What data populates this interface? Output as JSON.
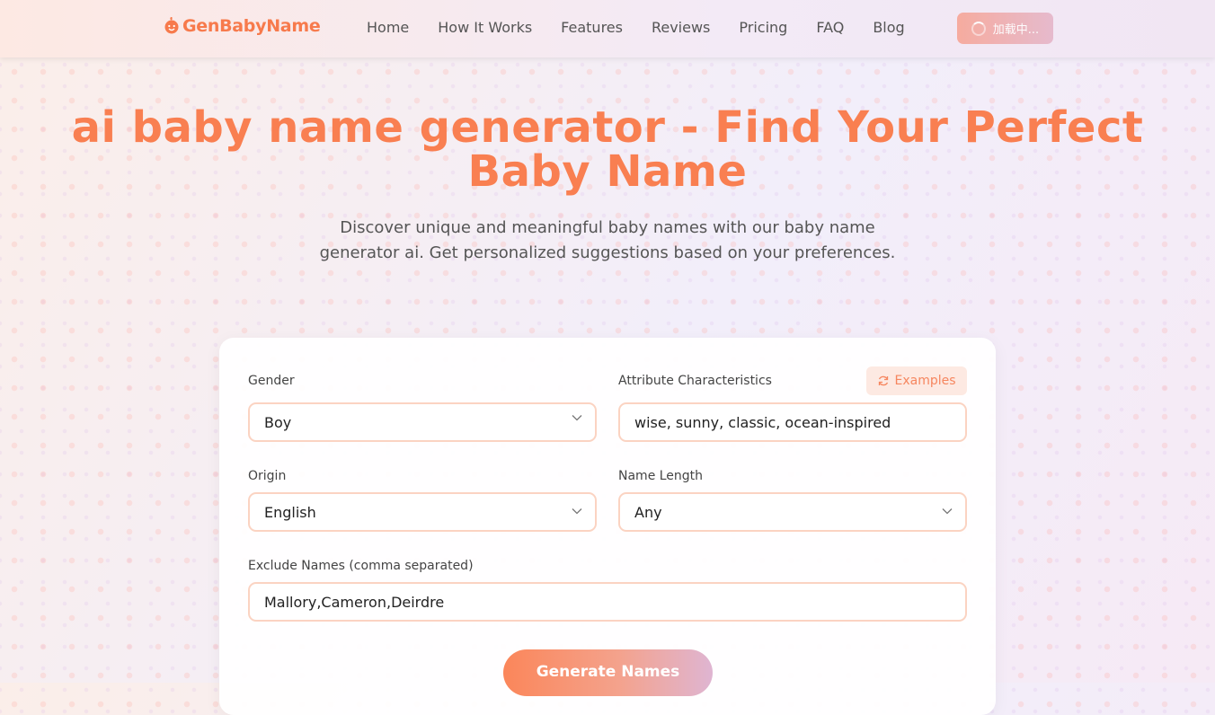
{
  "header": {
    "logo_text": "GenBabyName",
    "logo_icon": "baby-face-icon",
    "nav": [
      {
        "label": "Home"
      },
      {
        "label": "How It Works"
      },
      {
        "label": "Features"
      },
      {
        "label": "Reviews"
      },
      {
        "label": "Pricing"
      },
      {
        "label": "FAQ"
      },
      {
        "label": "Blog"
      }
    ],
    "loading_label": "加载中..."
  },
  "hero": {
    "title": "ai baby name generator - Find Your Perfect Baby Name",
    "subtitle": "Discover unique and meaningful baby names with our baby name generator ai. Get personalized suggestions based on your preferences."
  },
  "form": {
    "gender": {
      "label": "Gender",
      "value": "Boy"
    },
    "attributes": {
      "label": "Attribute Characteristics",
      "value": "wise, sunny, classic, ocean-inspired",
      "examples_label": "Examples"
    },
    "origin": {
      "label": "Origin",
      "value": "English"
    },
    "name_length": {
      "label": "Name Length",
      "value": "Any"
    },
    "exclude": {
      "label": "Exclude Names (comma separated)",
      "value": "Mallory,Cameron,Deirdre"
    },
    "submit_label": "Generate Names"
  },
  "colors": {
    "accent": "#f97f51",
    "field_border": "#fbd3c2"
  }
}
